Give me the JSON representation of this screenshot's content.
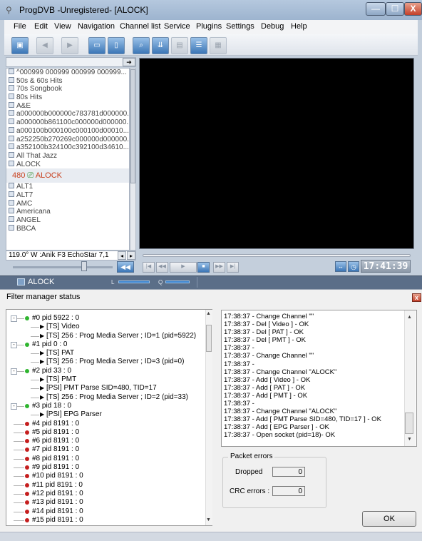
{
  "main_window": {
    "title": "ProgDVB -Unregistered-  [ALOCK]",
    "menus": [
      "File",
      "Edit",
      "View",
      "Navigation",
      "Channel list",
      "Service",
      "Plugins",
      "Settings",
      "Debug",
      "Help"
    ],
    "window_buttons": {
      "minimize": "—",
      "maximize": "☐",
      "close": "X"
    }
  },
  "channel_list": {
    "items_before": [
      "^000999 000999 000999 000999...",
      "50s & 60s Hits",
      "70s Songbook",
      "80s Hits",
      "A&E",
      "a000000b000000c783781d000000...",
      "a000000b861100c000000d000000...",
      "a000100b000100c000100d00010...",
      "a252250b270269c000000d000000...",
      "a352100b324100c392100d34610...",
      "All That Jazz",
      "ALOCK"
    ],
    "selected": {
      "number": "480",
      "name": "ALOCK"
    },
    "items_after": [
      "ALT1",
      "ALT7",
      "AMC",
      "Americana",
      "ANGEL",
      "BBCA"
    ],
    "satellite": "119.0° W :Anik F3   EchoStar 7,1"
  },
  "player": {
    "time": "17:41:39"
  },
  "statusbar": {
    "channel": "ALOCK",
    "l_label": "L",
    "q_label": "Q"
  },
  "dialog": {
    "title": "Filter manager status",
    "ok_label": "OK",
    "packet_errors": {
      "legend": "Packet errors",
      "dropped_label": "Dropped",
      "dropped_value": "0",
      "crc_label": "CRC errors :",
      "crc_value": "0"
    }
  },
  "tree": [
    {
      "kind": "pid",
      "status": "green",
      "expand": "-",
      "label": "#0 pid 5922 : 0"
    },
    {
      "kind": "child",
      "label": "[TS] Video"
    },
    {
      "kind": "child",
      "label": "[TS] 256 : Prog Media Server ;  ID=1  (pid=5922)"
    },
    {
      "kind": "pid",
      "status": "green",
      "expand": "-",
      "label": "#1 pid 0 : 0"
    },
    {
      "kind": "child",
      "label": "[TS] PAT"
    },
    {
      "kind": "child",
      "label": "[TS] 256 : Prog Media Server ;  ID=3  (pid=0)"
    },
    {
      "kind": "pid",
      "status": "green",
      "expand": "-",
      "label": "#2 pid 33 : 0"
    },
    {
      "kind": "child",
      "label": "[TS] PMT"
    },
    {
      "kind": "child",
      "label": "[PSI] PMT Parse SID=480, TID=17"
    },
    {
      "kind": "child",
      "label": "[TS] 256 : Prog Media Server ;  ID=2  (pid=33)"
    },
    {
      "kind": "pid",
      "status": "green",
      "expand": "-",
      "label": "#3 pid 18 : 0"
    },
    {
      "kind": "child",
      "label": "[PSI] EPG Parser"
    },
    {
      "kind": "pid",
      "status": "red",
      "label": "#4 pid 8191 : 0"
    },
    {
      "kind": "pid",
      "status": "red",
      "label": "#5 pid 8191 : 0"
    },
    {
      "kind": "pid",
      "status": "red",
      "label": "#6 pid 8191 : 0"
    },
    {
      "kind": "pid",
      "status": "red",
      "label": "#7 pid 8191 : 0"
    },
    {
      "kind": "pid",
      "status": "red",
      "label": "#8 pid 8191 : 0"
    },
    {
      "kind": "pid",
      "status": "red",
      "label": "#9 pid 8191 : 0"
    },
    {
      "kind": "pid",
      "status": "red",
      "label": "#10 pid 8191 : 0"
    },
    {
      "kind": "pid",
      "status": "red",
      "label": "#11 pid 8191 : 0"
    },
    {
      "kind": "pid",
      "status": "red",
      "label": "#12 pid 8191 : 0"
    },
    {
      "kind": "pid",
      "status": "red",
      "label": "#13 pid 8191 : 0"
    },
    {
      "kind": "pid",
      "status": "red",
      "label": "#14 pid 8191 : 0"
    },
    {
      "kind": "pid",
      "status": "red",
      "label": "#15 pid 8191 : 0"
    }
  ],
  "log": [
    "17:38:37 - Change Channel \"\"",
    "17:38:37 - Del [ Video ] - OK",
    "17:38:37 - Del [ PAT ] - OK",
    "17:38:37 - Del [ PMT ] - OK",
    "17:38:37 -",
    "17:38:37 - Change Channel \"\"",
    "17:38:37 -",
    "17:38:37 - Change Channel \"ALOCK\"",
    "17:38:37 - Add [ Video ] - OK",
    "17:38:37 - Add [ PAT ] - OK",
    "17:38:37 - Add [ PMT ] - OK",
    "17:38:37 -",
    "17:38:37 - Change Channel \"ALOCK\"",
    "17:38:37 - Add [ PMT Parse SID=480, TID=17 ] - OK",
    "17:38:37 - Add [ EPG Parser ] - OK",
    "17:38:37 - Open socket (pid=18)- OK"
  ],
  "colors": {
    "ok_green": "#2fb52f",
    "error_red": "#c51e1e",
    "selected_channel": "#c8401e"
  }
}
